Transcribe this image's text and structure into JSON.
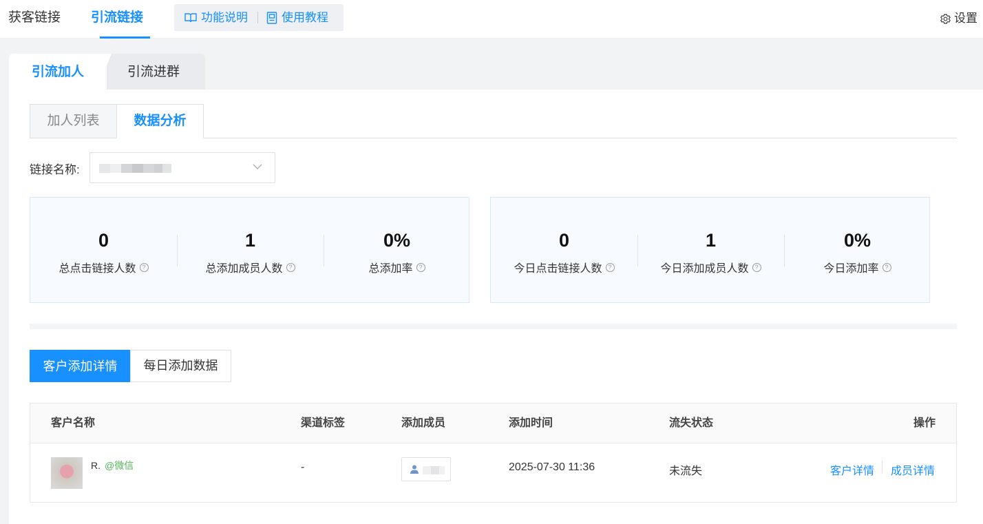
{
  "topbar": {
    "tabs": [
      {
        "label": "获客链接"
      },
      {
        "label": "引流链接"
      }
    ],
    "help": {
      "feature_label": "功能说明",
      "tutorial_label": "使用教程"
    },
    "settings_label": "设置"
  },
  "main_tabs": [
    {
      "label": "引流加人"
    },
    {
      "label": "引流进群"
    }
  ],
  "sub_tabs": [
    {
      "label": "加人列表"
    },
    {
      "label": "数据分析"
    }
  ],
  "filter": {
    "label": "链接名称:"
  },
  "stats_total": [
    {
      "value": "0",
      "label": "总点击链接人数"
    },
    {
      "value": "1",
      "label": "总添加成员人数"
    },
    {
      "value": "0%",
      "label": "总添加率"
    }
  ],
  "stats_today": [
    {
      "value": "0",
      "label": "今日点击链接人数"
    },
    {
      "value": "1",
      "label": "今日添加成员人数"
    },
    {
      "value": "0%",
      "label": "今日添加率"
    }
  ],
  "detail_tabs": [
    {
      "label": "客户添加详情"
    },
    {
      "label": "每日添加数据"
    }
  ],
  "table": {
    "headers": [
      "客户名称",
      "渠道标签",
      "添加成员",
      "添加时间",
      "流失状态",
      "操作"
    ],
    "rows": [
      {
        "customer_name": "R.",
        "customer_source": "@微信",
        "channel_tag": "-",
        "add_time": "2025-07-30 11:36",
        "churn_status": "未流失",
        "actions": [
          "客户详情",
          "成员详情"
        ]
      }
    ]
  },
  "colors": {
    "accent": "#1890ff",
    "wechat_green": "#52b35a"
  }
}
